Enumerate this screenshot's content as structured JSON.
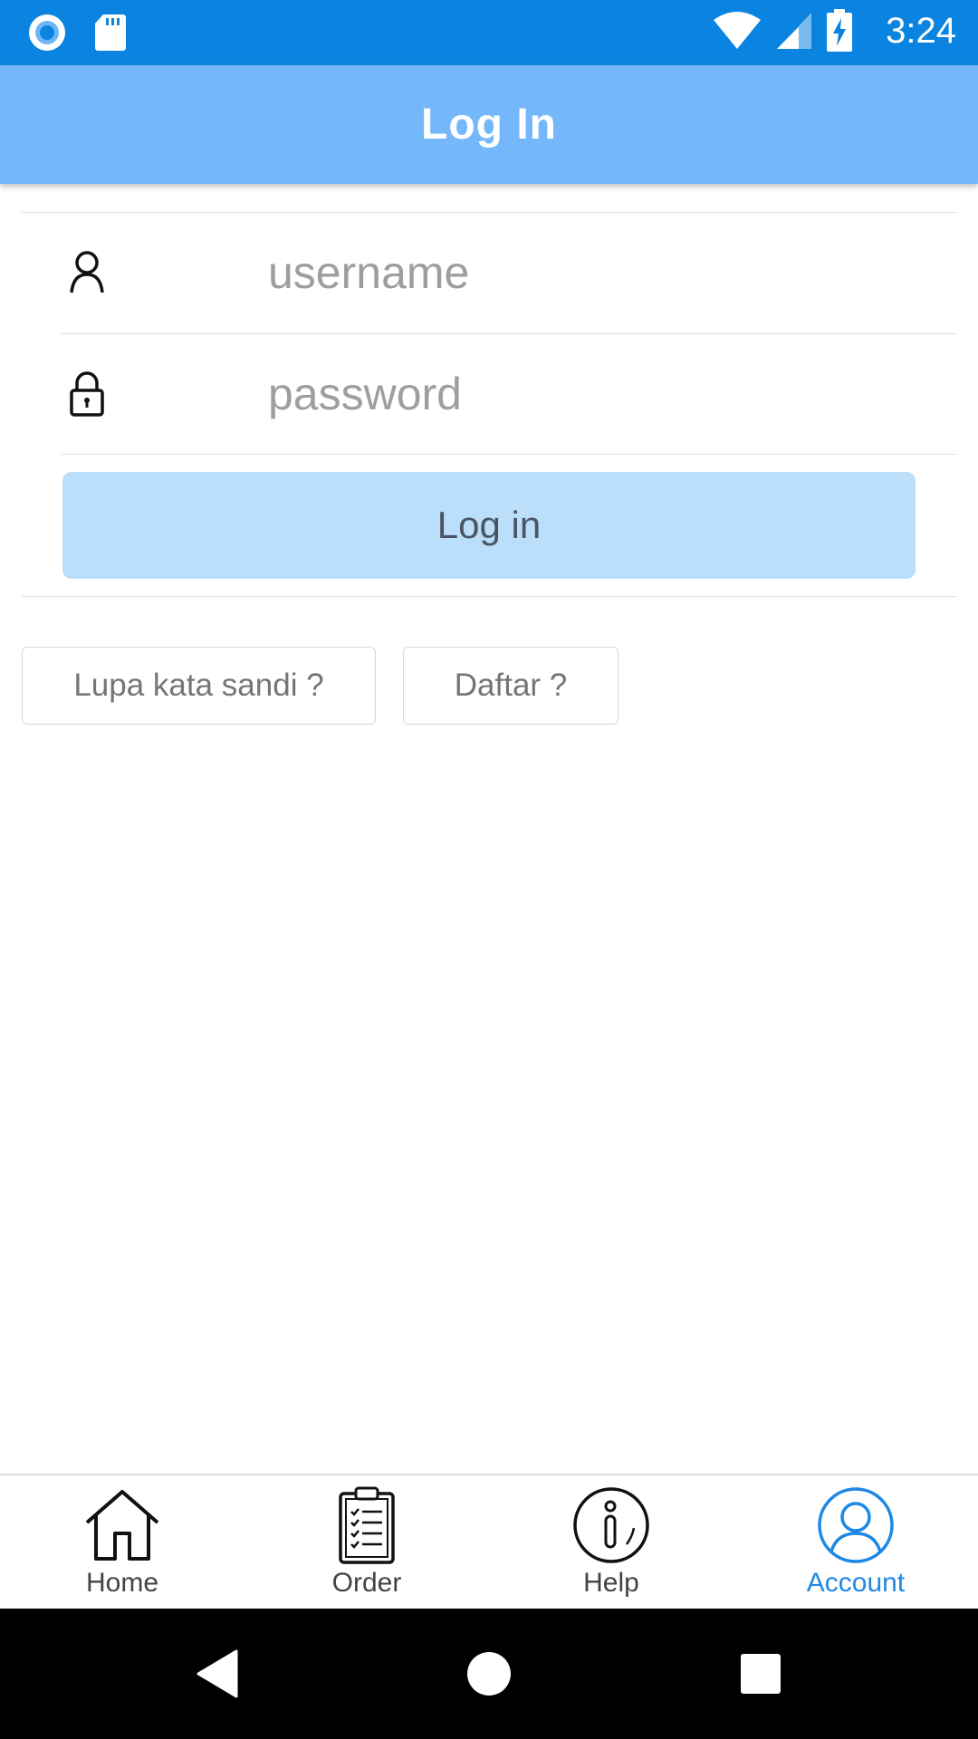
{
  "status_bar": {
    "time": "3:24",
    "icons": [
      "record-icon",
      "sd-card-icon",
      "wifi-icon",
      "signal-icon",
      "battery-charging-icon"
    ]
  },
  "app_bar": {
    "title": "Log In"
  },
  "form": {
    "username": {
      "value": "",
      "placeholder": "username",
      "icon": "user-icon"
    },
    "password": {
      "value": "",
      "placeholder": "password",
      "icon": "lock-icon"
    },
    "login_label": "Log in",
    "forgot_label": "Lupa kata sandi ?",
    "register_label": "Daftar ?"
  },
  "bottom_nav": {
    "items": [
      {
        "label": "Home",
        "icon": "home-icon",
        "active": false
      },
      {
        "label": "Order",
        "icon": "clipboard-icon",
        "active": false
      },
      {
        "label": "Help",
        "icon": "info-icon",
        "active": false
      },
      {
        "label": "Account",
        "icon": "account-icon",
        "active": true
      }
    ]
  },
  "system_nav": [
    "back-icon",
    "home-circle-icon",
    "recents-icon"
  ],
  "colors": {
    "status_bar": "#0a84e0",
    "app_bar": "#74b8fb",
    "login_button": "#bbdefa",
    "active_nav": "#1e88e5"
  }
}
